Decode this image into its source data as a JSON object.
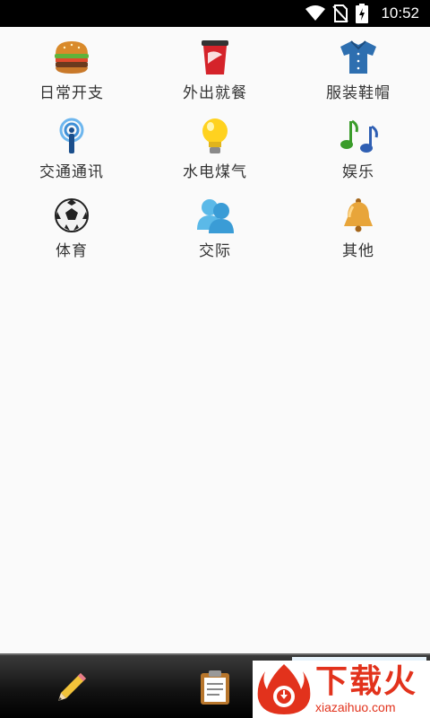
{
  "status_bar": {
    "time": "10:52",
    "icons": [
      "wifi-icon",
      "no-sim-icon",
      "battery-charging-icon"
    ]
  },
  "categories": [
    {
      "label": "日常开支",
      "icon": "hamburger-icon"
    },
    {
      "label": "外出就餐",
      "icon": "soda-cup-icon"
    },
    {
      "label": "服装鞋帽",
      "icon": "shirt-icon"
    },
    {
      "label": "交通通讯",
      "icon": "antenna-icon"
    },
    {
      "label": "水电煤气",
      "icon": "light-bulb-icon"
    },
    {
      "label": "娱乐",
      "icon": "music-notes-icon"
    },
    {
      "label": "体育",
      "icon": "soccer-ball-icon"
    },
    {
      "label": "交际",
      "icon": "people-icon"
    },
    {
      "label": "其他",
      "icon": "bell-icon"
    }
  ],
  "bottom_bar": {
    "tabs": [
      {
        "icon": "pencil-icon"
      },
      {
        "icon": "clipboard-icon"
      },
      {
        "icon": "chart-icon"
      }
    ]
  },
  "watermark": {
    "title": "下载火",
    "domain": "xiazaihuo.com"
  },
  "colors": {
    "background": "#fafafa",
    "status_bar": "#000000",
    "bottom_bar": "#111111",
    "watermark_red": "#e2321c"
  }
}
